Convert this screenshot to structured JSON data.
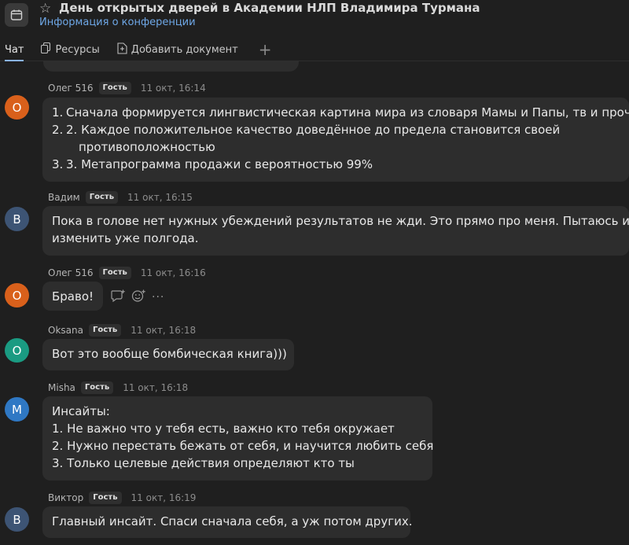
{
  "header": {
    "title": "День открытых дверей в Академии НЛП Владимира Турмана",
    "info_link": "Информация о конференции",
    "star_icon": "star-icon",
    "app_icon": "calendar-icon"
  },
  "tabs": [
    {
      "label": "Чат",
      "active": true
    },
    {
      "label": "Ресурсы",
      "icon": "copy-icon"
    },
    {
      "label": "Добавить документ",
      "icon": "doc-icon"
    },
    {
      "label": "+",
      "icon": "plus-icon"
    }
  ],
  "messages": [
    {
      "author": "Олег 516",
      "badge": "Гость",
      "time": "11 окт, 16:14",
      "initial": "О",
      "avatar_color": "#d9601b",
      "list": [
        {
          "num": "1.",
          "text": " Сначала формируется лингвистическая картина мира из словаря Мамы и Папы, тв и проч."
        },
        {
          "num": "2.",
          "text": "2. Каждое положительное качество доведённое до предела становится своей",
          "cont": "противоположностью"
        },
        {
          "num": "3.",
          "text": "3. Метапрограмма продажи с вероятностью 99%"
        }
      ]
    },
    {
      "author": "Вадим",
      "badge": "Гость",
      "time": "11 окт, 16:15",
      "initial": "В",
      "avatar_color": "#3d5474",
      "lines": [
        "Пока в голове нет нужных убеждений результатов не жди. Это прямо про меня. Пытаюсь их",
        "изменить уже полгода."
      ]
    },
    {
      "author": "Олег 516",
      "badge": "Гость",
      "time": "11 окт, 16:16",
      "initial": "О",
      "avatar_color": "#d9601b",
      "lines": [
        "Браво!"
      ],
      "actions": [
        "reply-icon",
        "emoji-icon",
        "more-icon"
      ]
    },
    {
      "author": "Oksana",
      "badge": "Гость",
      "time": "11 окт, 16:18",
      "initial": "О",
      "avatar_color": "#1a9b82",
      "lines": [
        "Вот это вообще бомбическая книга)))"
      ]
    },
    {
      "author": "Misha",
      "badge": "Гость",
      "time": "11 окт, 16:18",
      "initial": "М",
      "avatar_color": "#2f78c4",
      "lines": [
        "Инсайты:",
        "1. Не важно что у тебя есть, важно кто тебя окружает",
        "2. Нужно перестать бежать от себя, и научится любить себя",
        "3. Только целевые действия определяют кто ты"
      ]
    },
    {
      "author": "Виктор",
      "badge": "Гость",
      "time": "11 окт, 16:19",
      "initial": "В",
      "avatar_color": "#3d5474",
      "lines": [
        "Главный инсайт. Спаси сначала себя, а уж потом других."
      ]
    }
  ]
}
